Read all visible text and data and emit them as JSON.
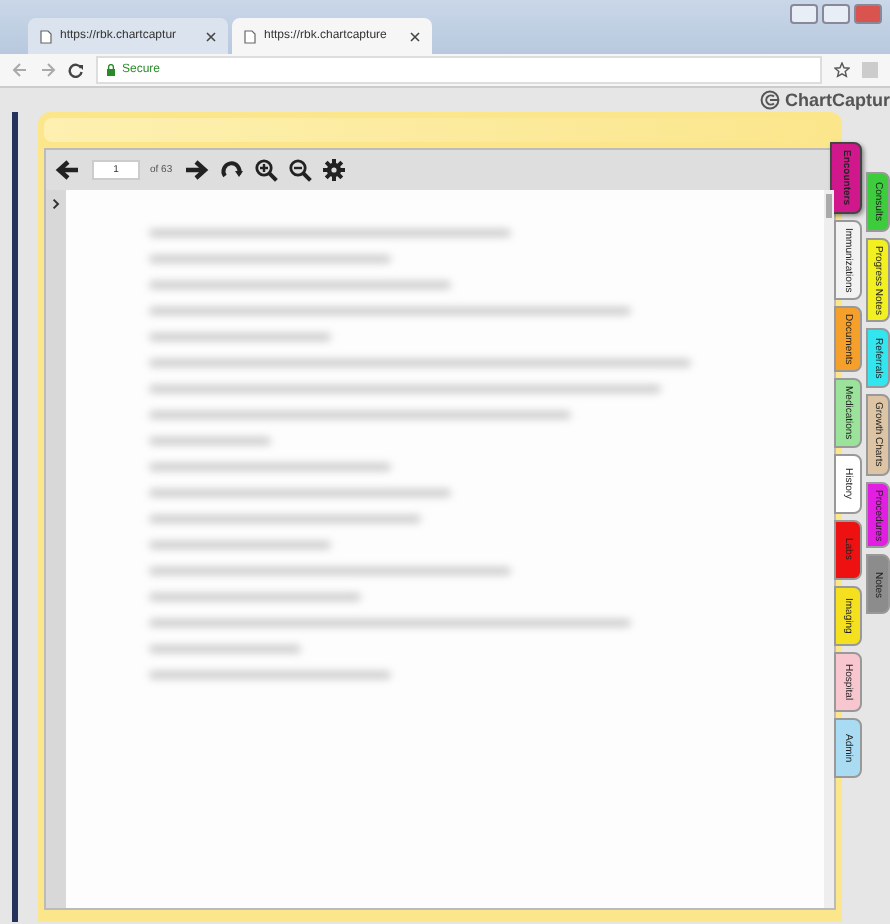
{
  "browser": {
    "tabs": [
      {
        "title": "https://rbk.chartcaptur",
        "selected": false
      },
      {
        "title": "https://rbk.chartcapture",
        "selected": true
      }
    ],
    "security": "Secure"
  },
  "app": {
    "logo": "ChartCaptur"
  },
  "viewer": {
    "page": "1",
    "page_count": "of 63"
  },
  "side_tabs_left": [
    {
      "label": "Encounters",
      "color": "#d0188c",
      "selected": true
    },
    {
      "label": "Immunizations",
      "color": "#f2f2f2",
      "selected": false
    },
    {
      "label": "Documents",
      "color": "#f5a02a",
      "selected": false
    },
    {
      "label": "Medications",
      "color": "#9be39b",
      "selected": false
    },
    {
      "label": "History",
      "color": "#ffffff",
      "selected": false
    },
    {
      "label": "Labs",
      "color": "#ee1111",
      "selected": false
    },
    {
      "label": "Imaging",
      "color": "#f5e020",
      "selected": false
    },
    {
      "label": "Hospital",
      "color": "#f7c6cf",
      "selected": false
    },
    {
      "label": "Admin",
      "color": "#a9dcf2",
      "selected": false
    }
  ],
  "side_tabs_right": [
    {
      "label": "Consults",
      "color": "#3ccc3c",
      "selected": false
    },
    {
      "label": "Progress Notes",
      "color": "#f2f020",
      "selected": false
    },
    {
      "label": "Referrals",
      "color": "#33e5ef",
      "selected": false
    },
    {
      "label": "Growth Charts",
      "color": "#dcc4a4",
      "selected": false
    },
    {
      "label": "Procedures",
      "color": "#e21ee2",
      "selected": false
    },
    {
      "label": "Notes",
      "color": "#8c8c8c",
      "selected": false
    }
  ]
}
